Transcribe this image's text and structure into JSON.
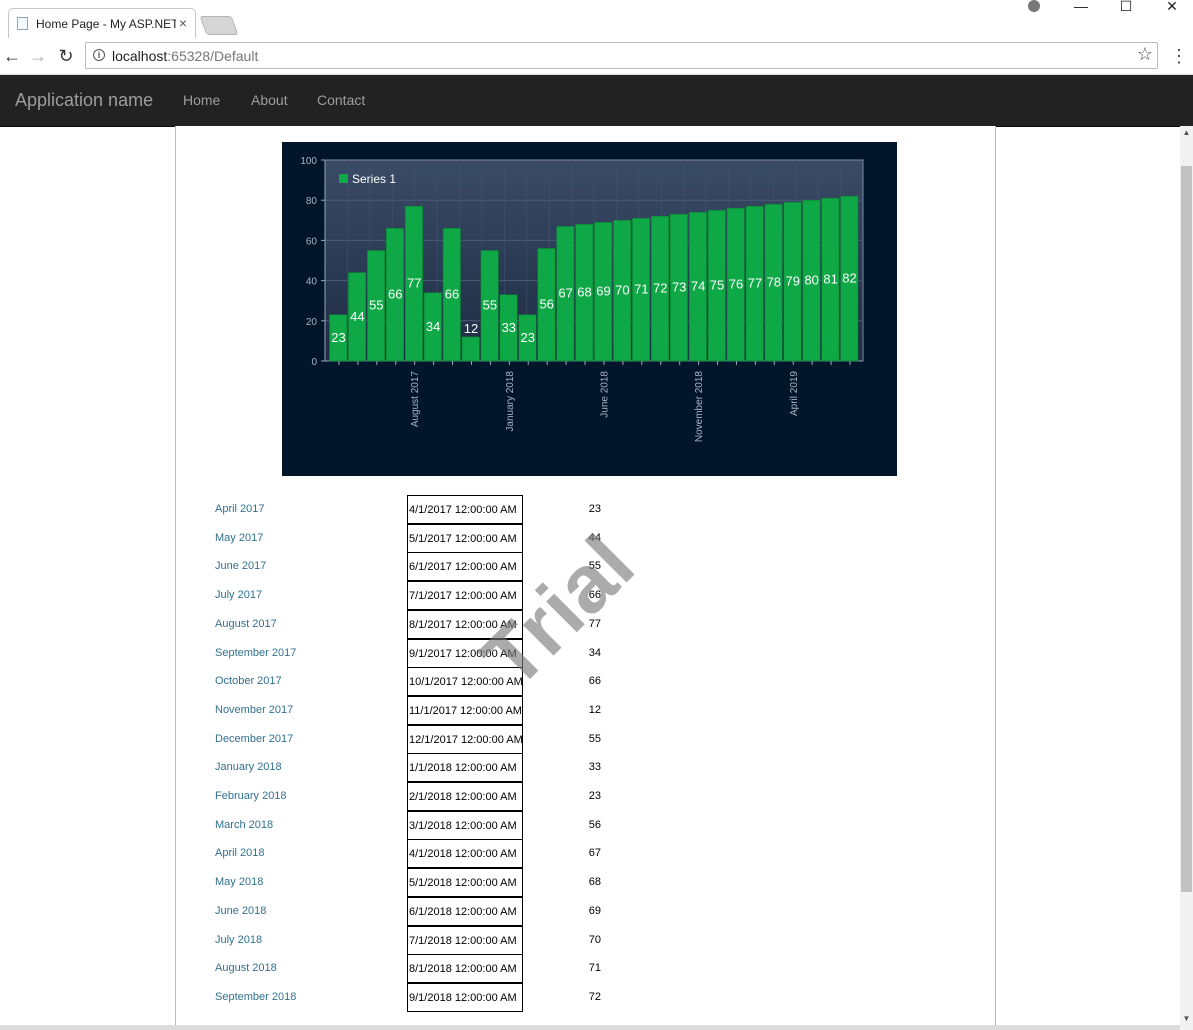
{
  "browser": {
    "tab_title": "Home Page - My ASP.NET",
    "tab_close": "×",
    "url_host": "localhost",
    "url_path": ":65328/Default",
    "win_min": "—",
    "win_max": "☐",
    "win_close": "✕"
  },
  "navbar": {
    "brand": "Application name",
    "links": [
      "Home",
      "About",
      "Contact"
    ]
  },
  "watermark": "Trial",
  "chart_data": {
    "type": "bar",
    "series": [
      {
        "name": "Series 1",
        "values": [
          23,
          44,
          55,
          66,
          77,
          34,
          66,
          12,
          55,
          33,
          23,
          56,
          67,
          68,
          69,
          70,
          71,
          72,
          73,
          74,
          75,
          76,
          77,
          78,
          79,
          80,
          81,
          82
        ]
      }
    ],
    "ylim": [
      0,
      100
    ],
    "yticks": [
      "0",
      "20",
      "40",
      "60",
      "80",
      "100"
    ],
    "x_tick_labels": [
      "August 2017",
      "January 2018",
      "June 2018",
      "November 2018",
      "April 2019"
    ],
    "legend_position": "top-left",
    "grid": true,
    "colors": {
      "bar": "#0fa846",
      "background": "#02162b",
      "plot_area": "#2e3e58",
      "label": "#ffffff"
    }
  },
  "rows": [
    {
      "label": "April 2017",
      "date": "4/1/2017 12:00:00 AM",
      "value": "23"
    },
    {
      "label": "May 2017",
      "date": "5/1/2017 12:00:00 AM",
      "value": "44"
    },
    {
      "label": "June 2017",
      "date": "6/1/2017 12:00:00 AM",
      "value": "55"
    },
    {
      "label": "July 2017",
      "date": "7/1/2017 12:00:00 AM",
      "value": "66"
    },
    {
      "label": "August 2017",
      "date": "8/1/2017 12:00:00 AM",
      "value": "77"
    },
    {
      "label": "September 2017",
      "date": "9/1/2017 12:00:00 AM",
      "value": "34"
    },
    {
      "label": "October 2017",
      "date": "10/1/2017 12:00:00 AM",
      "value": "66"
    },
    {
      "label": "November 2017",
      "date": "11/1/2017 12:00:00 AM",
      "value": "12"
    },
    {
      "label": "December 2017",
      "date": "12/1/2017 12:00:00 AM",
      "value": "55"
    },
    {
      "label": "January 2018",
      "date": "1/1/2018 12:00:00 AM",
      "value": "33"
    },
    {
      "label": "February 2018",
      "date": "2/1/2018 12:00:00 AM",
      "value": "23"
    },
    {
      "label": "March 2018",
      "date": "3/1/2018 12:00:00 AM",
      "value": "56"
    },
    {
      "label": "April 2018",
      "date": "4/1/2018 12:00:00 AM",
      "value": "67"
    },
    {
      "label": "May 2018",
      "date": "5/1/2018 12:00:00 AM",
      "value": "68"
    },
    {
      "label": "June 2018",
      "date": "6/1/2018 12:00:00 AM",
      "value": "69"
    },
    {
      "label": "July 2018",
      "date": "7/1/2018 12:00:00 AM",
      "value": "70"
    },
    {
      "label": "August 2018",
      "date": "8/1/2018 12:00:00 AM",
      "value": "71"
    },
    {
      "label": "September 2018",
      "date": "9/1/2018 12:00:00 AM",
      "value": "72"
    }
  ]
}
